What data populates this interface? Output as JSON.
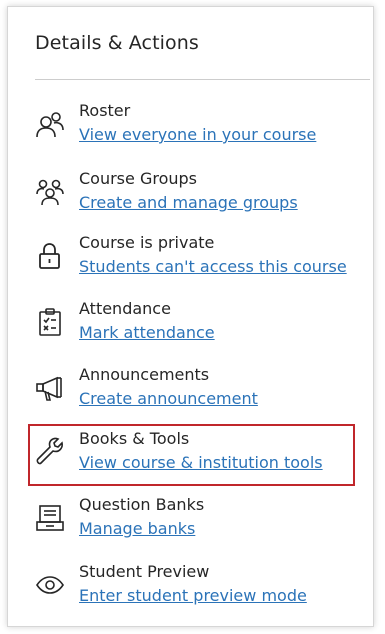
{
  "panel": {
    "title": "Details & Actions"
  },
  "items": [
    {
      "name": "Roster",
      "link": "View everyone in your course",
      "icon": "roster-icon"
    },
    {
      "name": "Course Groups",
      "link": "Create and manage groups",
      "icon": "groups-icon"
    },
    {
      "name": "Course is private",
      "link": "Students can't access this course",
      "icon": "lock-icon"
    },
    {
      "name": "Attendance",
      "link": "Mark attendance",
      "icon": "attendance-icon"
    },
    {
      "name": "Announcements",
      "link": "Create announcement",
      "icon": "megaphone-icon"
    },
    {
      "name": "Books & Tools",
      "link": "View course & institution tools",
      "icon": "wrench-icon"
    },
    {
      "name": "Question Banks",
      "link": "Manage banks",
      "icon": "question-bank-icon"
    },
    {
      "name": "Student Preview",
      "link": "Enter student preview mode",
      "icon": "eye-icon"
    }
  ],
  "colors": {
    "link": "#2b73b8",
    "text": "#262626",
    "highlight": "#c0262b"
  }
}
